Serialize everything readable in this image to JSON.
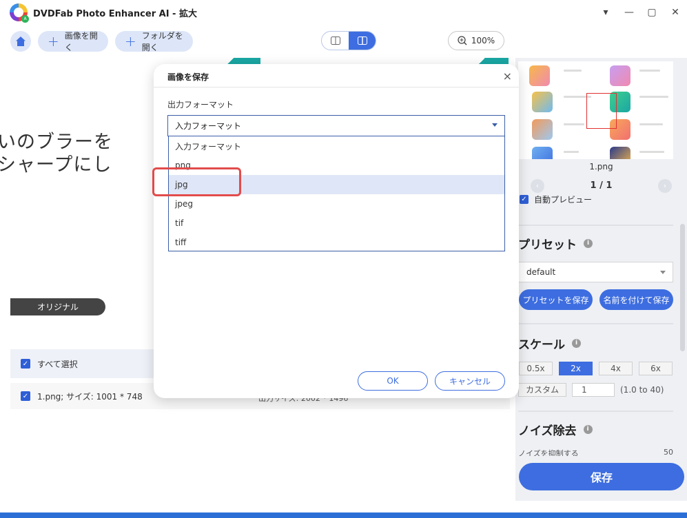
{
  "window": {
    "title": "DVDFab Photo Enhancer AI - 拡大",
    "controls": [
      "▾",
      "—",
      "▢",
      "✕"
    ]
  },
  "toolbar": {
    "open_image": "画像を開く",
    "open_folder": "フォルダを開く",
    "zoom": "100%"
  },
  "canvas": {
    "text_line1": "いのブラーを",
    "text_line2": "シャープにし",
    "original_label": "オリジナル"
  },
  "list": {
    "select_all": "すべて選択",
    "row_text": "1.png; サイズ: 1001 * 748",
    "row_output": "出力サイズ: 2002 * 1496"
  },
  "dialog": {
    "title": "画像を保存",
    "close": "×",
    "format_label": "出力フォーマット",
    "selected": "入力フォーマット",
    "options": [
      "入力フォーマット",
      "png",
      "jpg",
      "jpeg",
      "tif",
      "tiff"
    ],
    "highlighted_option": "jpg",
    "ok": "OK",
    "cancel": "キャンセル"
  },
  "right_panel": {
    "thumb_name": "1.png",
    "pager": "1 / 1",
    "auto_preview": "自動プレビュー",
    "preset_title": "プリセット",
    "preset_value": "default",
    "save_preset": "プリセットを保存",
    "save_as": "名前を付けて保存",
    "scale_title": "スケール",
    "scales": [
      "0.5x",
      "2x",
      "4x",
      "6x"
    ],
    "active_scale": "2x",
    "custom_label": "カスタム",
    "custom_value": "1",
    "custom_range": "(1.0 to 40)",
    "noise_title": "ノイズ除去",
    "noise_sub": "ノイズを抑制する",
    "noise_value": "50",
    "save_button": "保存"
  },
  "colors": {
    "accent": "#3d6de0",
    "highlight_box": "#e24b4b",
    "bottom_bar": "#2b6fd6"
  }
}
